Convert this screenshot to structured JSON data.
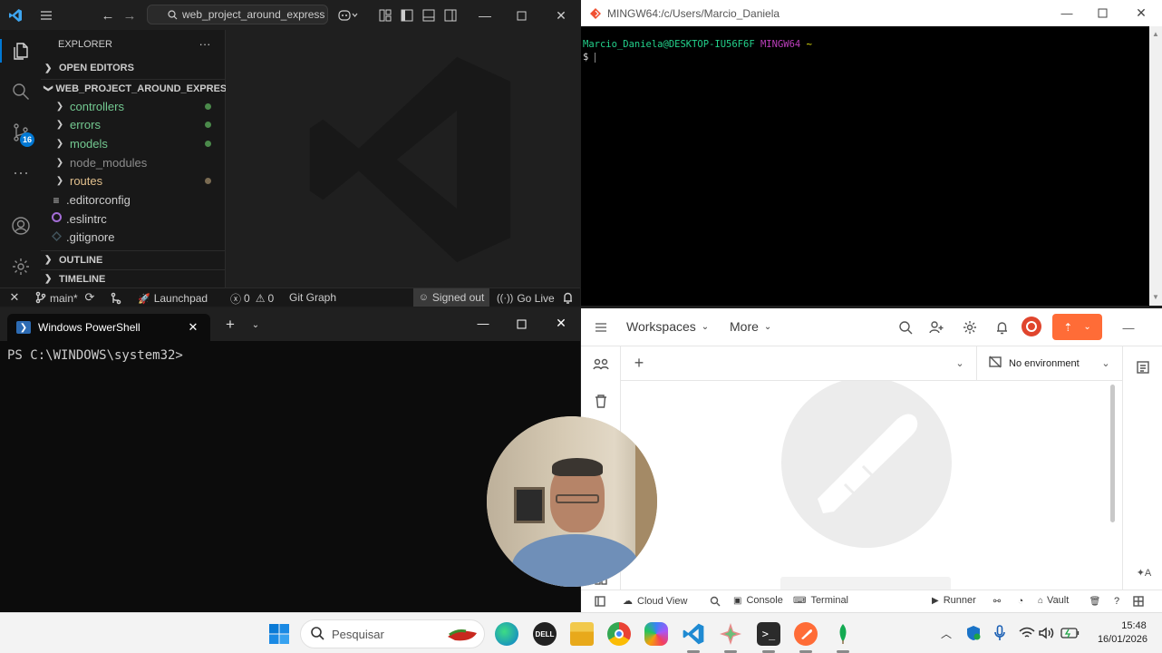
{
  "vscode": {
    "search": "web_project_around_express",
    "explorer_label": "EXPLORER",
    "open_editors": "OPEN EDITORS",
    "project": "WEB_PROJECT_AROUND_EXPRESS",
    "tree": [
      {
        "label": "controllers",
        "kind": "folder",
        "color": "#73c991",
        "dot": "#4b8a4b"
      },
      {
        "label": "errors",
        "kind": "folder",
        "color": "#73c991",
        "dot": "#4b8a4b"
      },
      {
        "label": "models",
        "kind": "folder",
        "color": "#73c991",
        "dot": "#4b8a4b"
      },
      {
        "label": "node_modules",
        "kind": "folder",
        "color": "#8c8c8c",
        "dot": ""
      },
      {
        "label": "routes",
        "kind": "folder",
        "color": "#e2c08d",
        "dot": "#7a6b52"
      },
      {
        "label": ".editorconfig",
        "kind": "file",
        "color": "#cccccc",
        "dot": ""
      },
      {
        "label": ".eslintrc",
        "kind": "file",
        "color": "#cccccc",
        "dot": ""
      },
      {
        "label": ".gitignore",
        "kind": "file",
        "color": "#cccccc",
        "dot": ""
      }
    ],
    "outline": "OUTLINE",
    "timeline": "TIMELINE",
    "scm_badge": "16",
    "status": {
      "branch": "main*",
      "launchpad": "Launchpad",
      "errors": "0",
      "warnings": "0",
      "git_graph": "Git Graph",
      "signed_out": "Signed out",
      "go_live": "Go Live"
    }
  },
  "mingw": {
    "title": "MINGW64:/c/Users/Marcio_Daniela",
    "prompt_user": "Marcio_Daniela@DESKTOP-IU56F6F",
    "prompt_env": "MINGW64",
    "prompt_path": "~",
    "prompt_symbol": "$"
  },
  "powershell": {
    "tab_title": "Windows PowerShell",
    "prompt": "PS C:\\WINDOWS\\system32>"
  },
  "postman": {
    "workspaces": "Workspaces",
    "more": "More",
    "environment": "No environment",
    "bottom": {
      "cloud_view": "Cloud View",
      "console": "Console",
      "terminal": "Terminal",
      "runner": "Runner",
      "vault": "Vault"
    }
  },
  "taskbar": {
    "search_placeholder": "Pesquisar",
    "time": "15:48",
    "date": "16/01/2026"
  }
}
